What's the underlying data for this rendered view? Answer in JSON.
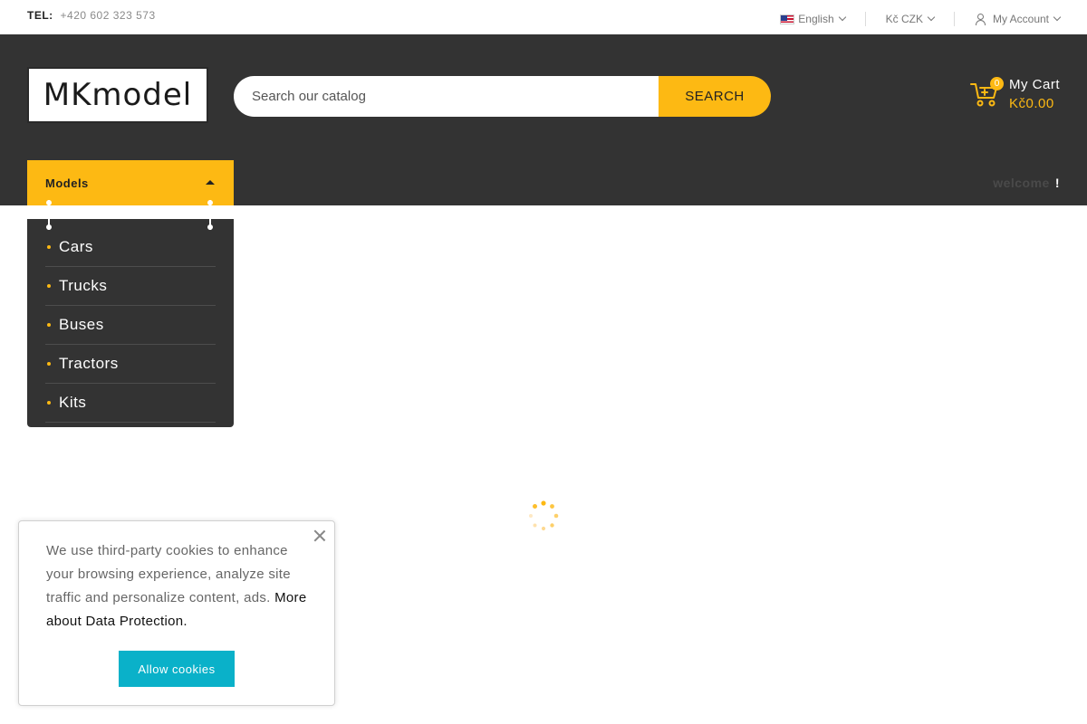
{
  "topbar": {
    "tel_label": "TEL:",
    "tel_number": "+420 602 323 573",
    "language": "English",
    "currency": "Kč CZK",
    "account": "My Account"
  },
  "header": {
    "logo_text": "MKmodel",
    "search_placeholder": "Search our catalog",
    "search_button": "SEARCH",
    "cart_count": "0",
    "cart_title": "My Cart",
    "cart_total": "Kč0.00"
  },
  "nav": {
    "models_label": "Models",
    "welcome": "welcome",
    "welcome_bang": "!"
  },
  "menu": {
    "items": [
      {
        "label": "Cars"
      },
      {
        "label": "Trucks"
      },
      {
        "label": "Buses"
      },
      {
        "label": "Tractors"
      },
      {
        "label": "Kits"
      }
    ]
  },
  "cookie": {
    "text": "We use third-party cookies to enhance your browsing experience, analyze site traffic and personalize content, ads.",
    "link": "More about Data Protection.",
    "button": "Allow cookies"
  },
  "colors": {
    "accent": "#fdb913",
    "header_bg": "#333333",
    "cookie_button": "#0ab1c9"
  }
}
